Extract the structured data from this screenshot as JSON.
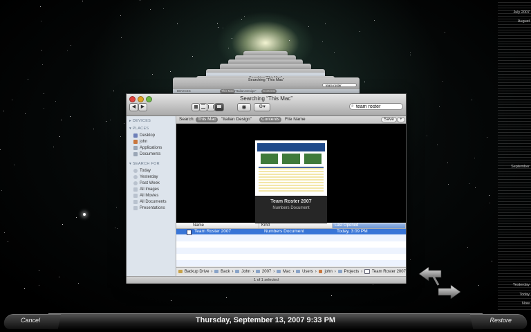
{
  "window": {
    "title": "Searching “This Mac”",
    "search_value": "team roster",
    "toolbar": {
      "back": "◀",
      "forward": "▶"
    }
  },
  "back_windows": {
    "titles": [
      "Searching “This Mac”",
      "Searching “This Mac”"
    ],
    "search_value": "team roster",
    "scope_labels": [
      "This Mac",
      "\"Italian Design\"",
      "Contents"
    ],
    "devices_label": "DEVICES"
  },
  "sidebar": {
    "devices_header": "DEVICES",
    "places_header": "PLACES",
    "places": [
      "Desktop",
      "john",
      "Applications",
      "Documents"
    ],
    "search_header": "SEARCH FOR",
    "search_items": [
      "Today",
      "Yesterday",
      "Past Week",
      "All Images",
      "All Movies",
      "All Documents",
      "Presentations"
    ]
  },
  "scopebar": {
    "label": "Search:",
    "this_mac": "This Mac",
    "folder": "\"Italian Design\"",
    "contents": "Contents",
    "file_name": "File Name",
    "save": "Save",
    "add": "+"
  },
  "preview": {
    "doc_title": "Team Roster 2007",
    "doc_kind": "Numbers Document"
  },
  "columns": {
    "name": "Name",
    "kind": "Kind",
    "last_opened": "Last Opened"
  },
  "rows": [
    {
      "name": "Team Roster 2007",
      "kind": "Numbers Document",
      "last_opened": "Today, 3:09 PM"
    }
  ],
  "path": [
    "Backup Drive",
    "Back",
    "John",
    "2007",
    "Mac",
    "Users",
    "john",
    "Projects",
    "Team Roster 2007"
  ],
  "status": "1 of 1 selected",
  "timeline": {
    "labels": [
      "July 2007",
      "August",
      "September",
      "Yesterday",
      "Today",
      "Now"
    ]
  },
  "bottom_bar": {
    "cancel": "Cancel",
    "datetime": "Thursday, September 13, 2007 9:33 PM",
    "restore": "Restore"
  },
  "colors": {
    "selection": "#3875d7",
    "sidebar": "#dde4ec"
  }
}
